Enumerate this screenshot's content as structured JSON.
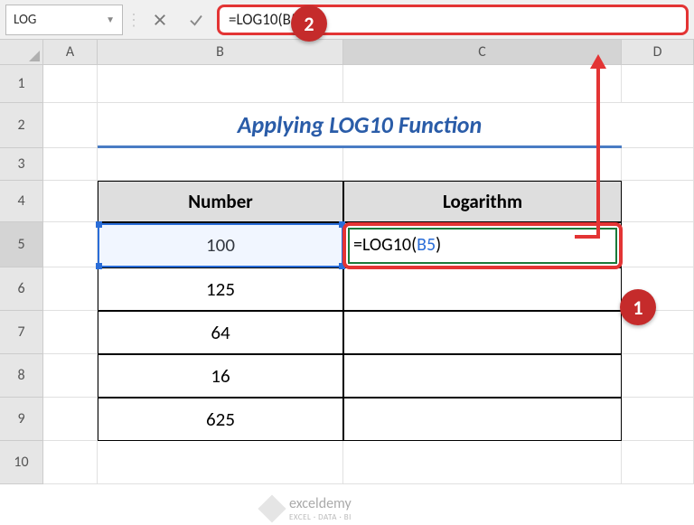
{
  "namebox": {
    "value": "LOG"
  },
  "formula_bar": {
    "formula_plain": "=LOG10(B5)",
    "prefix": "=LOG10(",
    "ref": "B5",
    "suffix": ")"
  },
  "columns": [
    "A",
    "B",
    "C",
    "D"
  ],
  "rows": [
    "1",
    "2",
    "3",
    "4",
    "5",
    "6",
    "7",
    "8",
    "9",
    "10"
  ],
  "title": "Applying LOG10 Function",
  "table": {
    "headers": [
      "Number",
      "Logarithm"
    ],
    "rows": [
      {
        "number": "100",
        "log": ""
      },
      {
        "number": "125",
        "log": ""
      },
      {
        "number": "64",
        "log": ""
      },
      {
        "number": "16",
        "log": ""
      },
      {
        "number": "625",
        "log": ""
      }
    ]
  },
  "cell_formula": {
    "prefix": "=LOG10(",
    "ref": "B5",
    "suffix": ")"
  },
  "callouts": {
    "badge1": "1",
    "badge2": "2"
  },
  "watermark": {
    "brand": "exceldemy",
    "tag": "EXCEL · DATA · BI"
  }
}
